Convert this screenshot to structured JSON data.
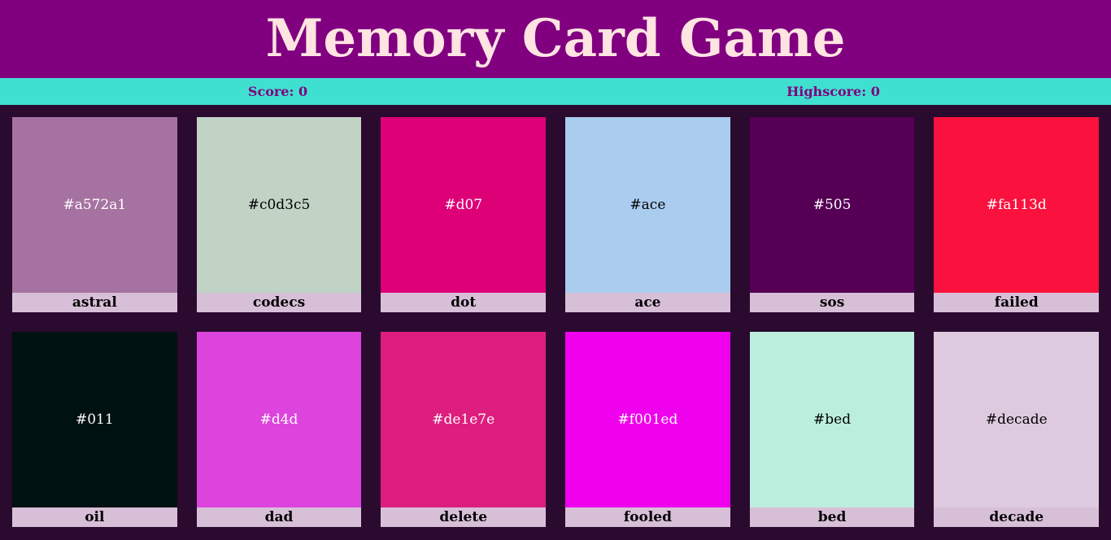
{
  "header": {
    "title": "Memory Card Game"
  },
  "scoreboard": {
    "score": "Score: 0",
    "highscore": "Highscore: 0"
  },
  "colors": {
    "header_bg": "#800080",
    "title_text": "#ffe4e1",
    "scorebar_bg": "#40e0d0",
    "scorebar_text": "#800080",
    "page_bg": "#2a0a2e",
    "label_bg": "#d8bfd8"
  },
  "cards": [
    {
      "hex": "#a572a1",
      "name": "astral",
      "text_color": "#ffffff"
    },
    {
      "hex": "#c0d3c5",
      "name": "codecs",
      "text_color": "#000000"
    },
    {
      "hex": "#d07",
      "name": "dot",
      "text_color": "#ffffff"
    },
    {
      "hex": "#ace",
      "name": "ace",
      "text_color": "#000000"
    },
    {
      "hex": "#505",
      "name": "sos",
      "text_color": "#ffffff"
    },
    {
      "hex": "#fa113d",
      "name": "failed",
      "text_color": "#ffffff"
    },
    {
      "hex": "#011",
      "name": "oil",
      "text_color": "#ffffff"
    },
    {
      "hex": "#d4d",
      "name": "dad",
      "text_color": "#ffffff"
    },
    {
      "hex": "#de1e7e",
      "name": "delete",
      "text_color": "#ffffff"
    },
    {
      "hex": "#f001ed",
      "name": "fooled",
      "text_color": "#ffffff"
    },
    {
      "hex": "#bed",
      "name": "bed",
      "text_color": "#000000"
    },
    {
      "hex": "#decade",
      "name": "decade",
      "text_color": "#000000"
    }
  ]
}
